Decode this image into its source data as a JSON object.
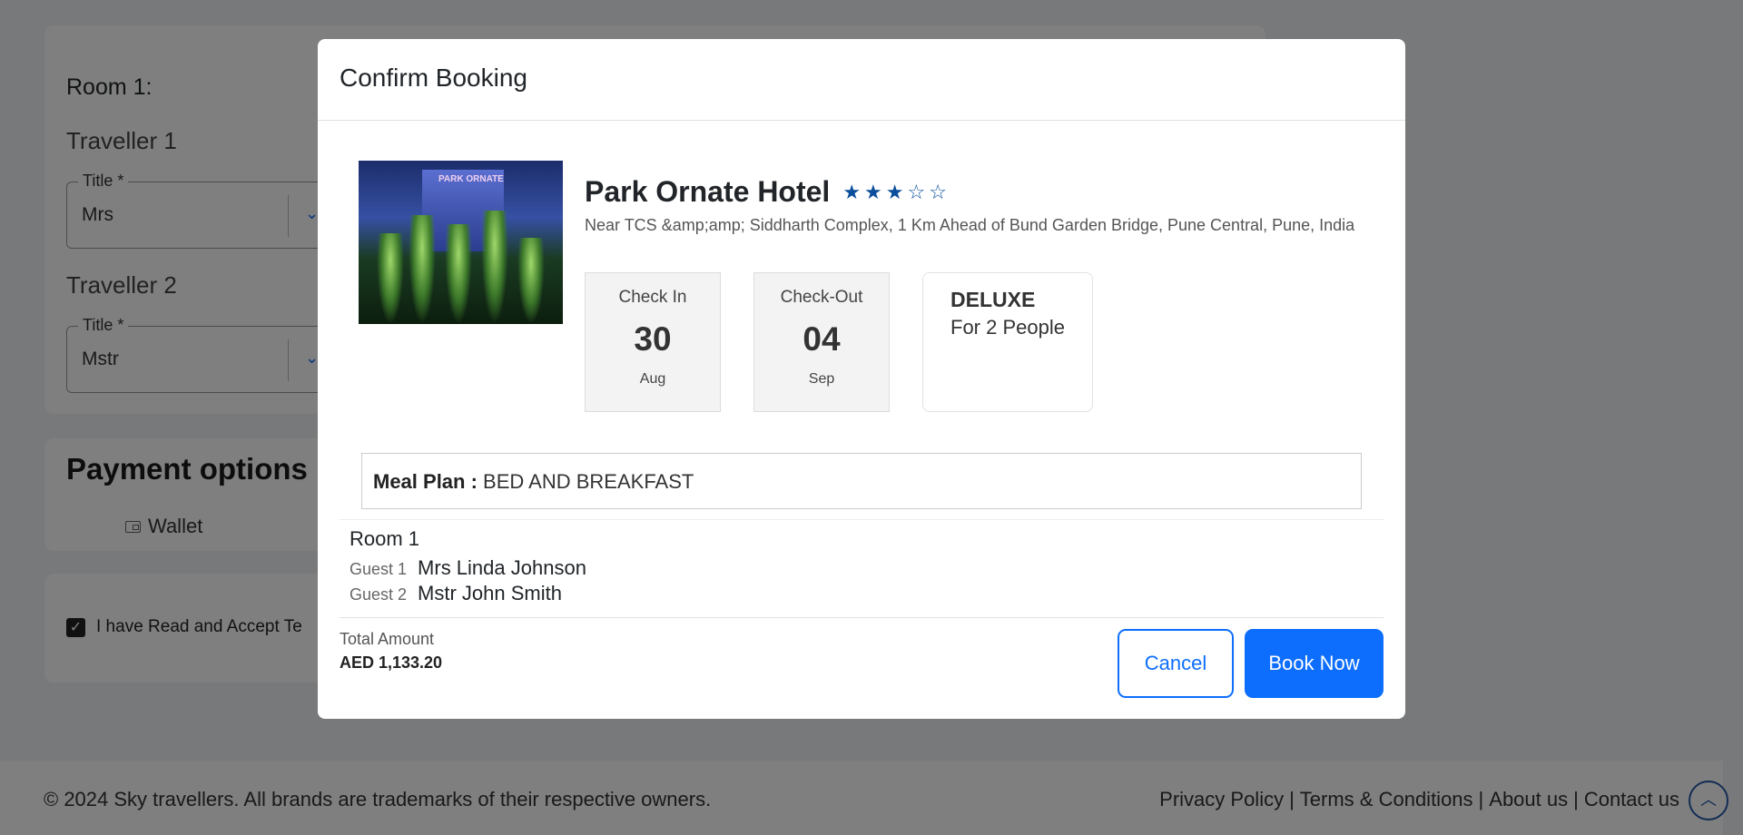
{
  "background": {
    "room_heading": "Room 1:",
    "traveller1_heading": "Traveller 1",
    "traveller1_title_label": "Title *",
    "traveller1_title_value": "Mrs",
    "traveller2_heading": "Traveller 2",
    "traveller2_title_label": "Title *",
    "traveller2_title_value": "Mstr",
    "payment_heading": "Payment options",
    "wallet_label": "Wallet",
    "accept_label": "I have Read and Accept Te",
    "footer_copy": "© 2024 Sky travellers. All brands are trademarks of their respective owners.",
    "footer_links": [
      "Privacy Policy",
      "|",
      "Terms & Conditions",
      "|",
      "About us",
      "|",
      "Contact us"
    ]
  },
  "modal": {
    "title": "Confirm Booking",
    "hotel": {
      "name": "Park Ornate Hotel",
      "rating": 3,
      "max_rating": 5,
      "image_sign": "PARK ORNATE",
      "address": "Near TCS &amp;amp; Siddharth Complex, 1 Km Ahead of Bund Garden Bridge, Pune Central, Pune, India"
    },
    "check_in": {
      "label": "Check In",
      "day": "30",
      "month": "Aug"
    },
    "check_out": {
      "label": "Check-Out",
      "day": "04",
      "month": "Sep"
    },
    "room": {
      "type": "DELUXE",
      "capacity": "For 2 People"
    },
    "meal": {
      "label": "Meal Plan :",
      "value": "BED AND BREAKFAST"
    },
    "room_info": {
      "title": "Room 1",
      "guests": [
        {
          "label": "Guest 1",
          "name": "Mrs Linda Johnson"
        },
        {
          "label": "Guest 2",
          "name": "Mstr John Smith"
        }
      ]
    },
    "total": {
      "label": "Total Amount",
      "value": "AED 1,133.20"
    },
    "buttons": {
      "cancel": "Cancel",
      "book": "Book Now"
    }
  },
  "colors": {
    "primary": "#0d6efd",
    "star": "#0b4f9c",
    "overlay": "rgba(0,0,0,0.5)"
  }
}
